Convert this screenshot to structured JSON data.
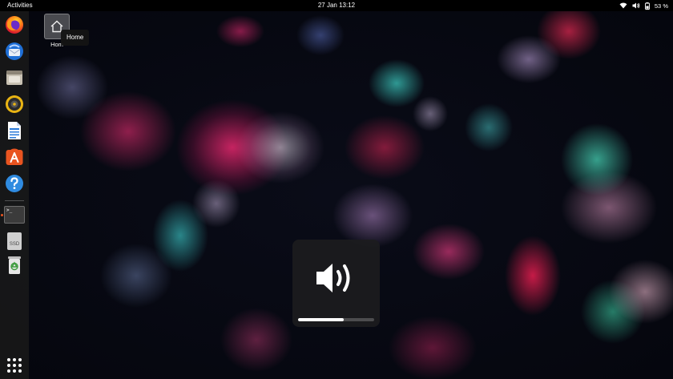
{
  "topbar": {
    "activities_label": "Activities",
    "datetime": "27 Jan  13:12",
    "battery_percent": "53 %"
  },
  "dock": {
    "items": [
      {
        "name": "firefox",
        "icon": "firefox-icon"
      },
      {
        "name": "thunderbird",
        "icon": "thunderbird-mail-icon"
      },
      {
        "name": "files",
        "icon": "folder-icon"
      },
      {
        "name": "rhythmbox",
        "icon": "speaker-music-icon"
      },
      {
        "name": "libreoffice-writer",
        "icon": "document-icon"
      },
      {
        "name": "software",
        "icon": "app-store-icon"
      },
      {
        "name": "help",
        "icon": "help-icon"
      },
      {
        "name": "terminal",
        "icon": "terminal-icon",
        "terminal_prompt": ">_"
      },
      {
        "name": "ssd-drive",
        "icon": "drive-icon",
        "drive_label": "SSD"
      },
      {
        "name": "trash",
        "icon": "trash-icon"
      }
    ],
    "show_apps_icon": "apps-grid-icon"
  },
  "desktop": {
    "home_icon_label": "Hom",
    "tooltip": "Home"
  },
  "volume_osd": {
    "icon": "speaker-volume-icon",
    "level_percent": 60
  },
  "colors": {
    "ubuntu_orange": "#e95420",
    "panel_black": "#000000",
    "dock_bg": "#191919"
  }
}
